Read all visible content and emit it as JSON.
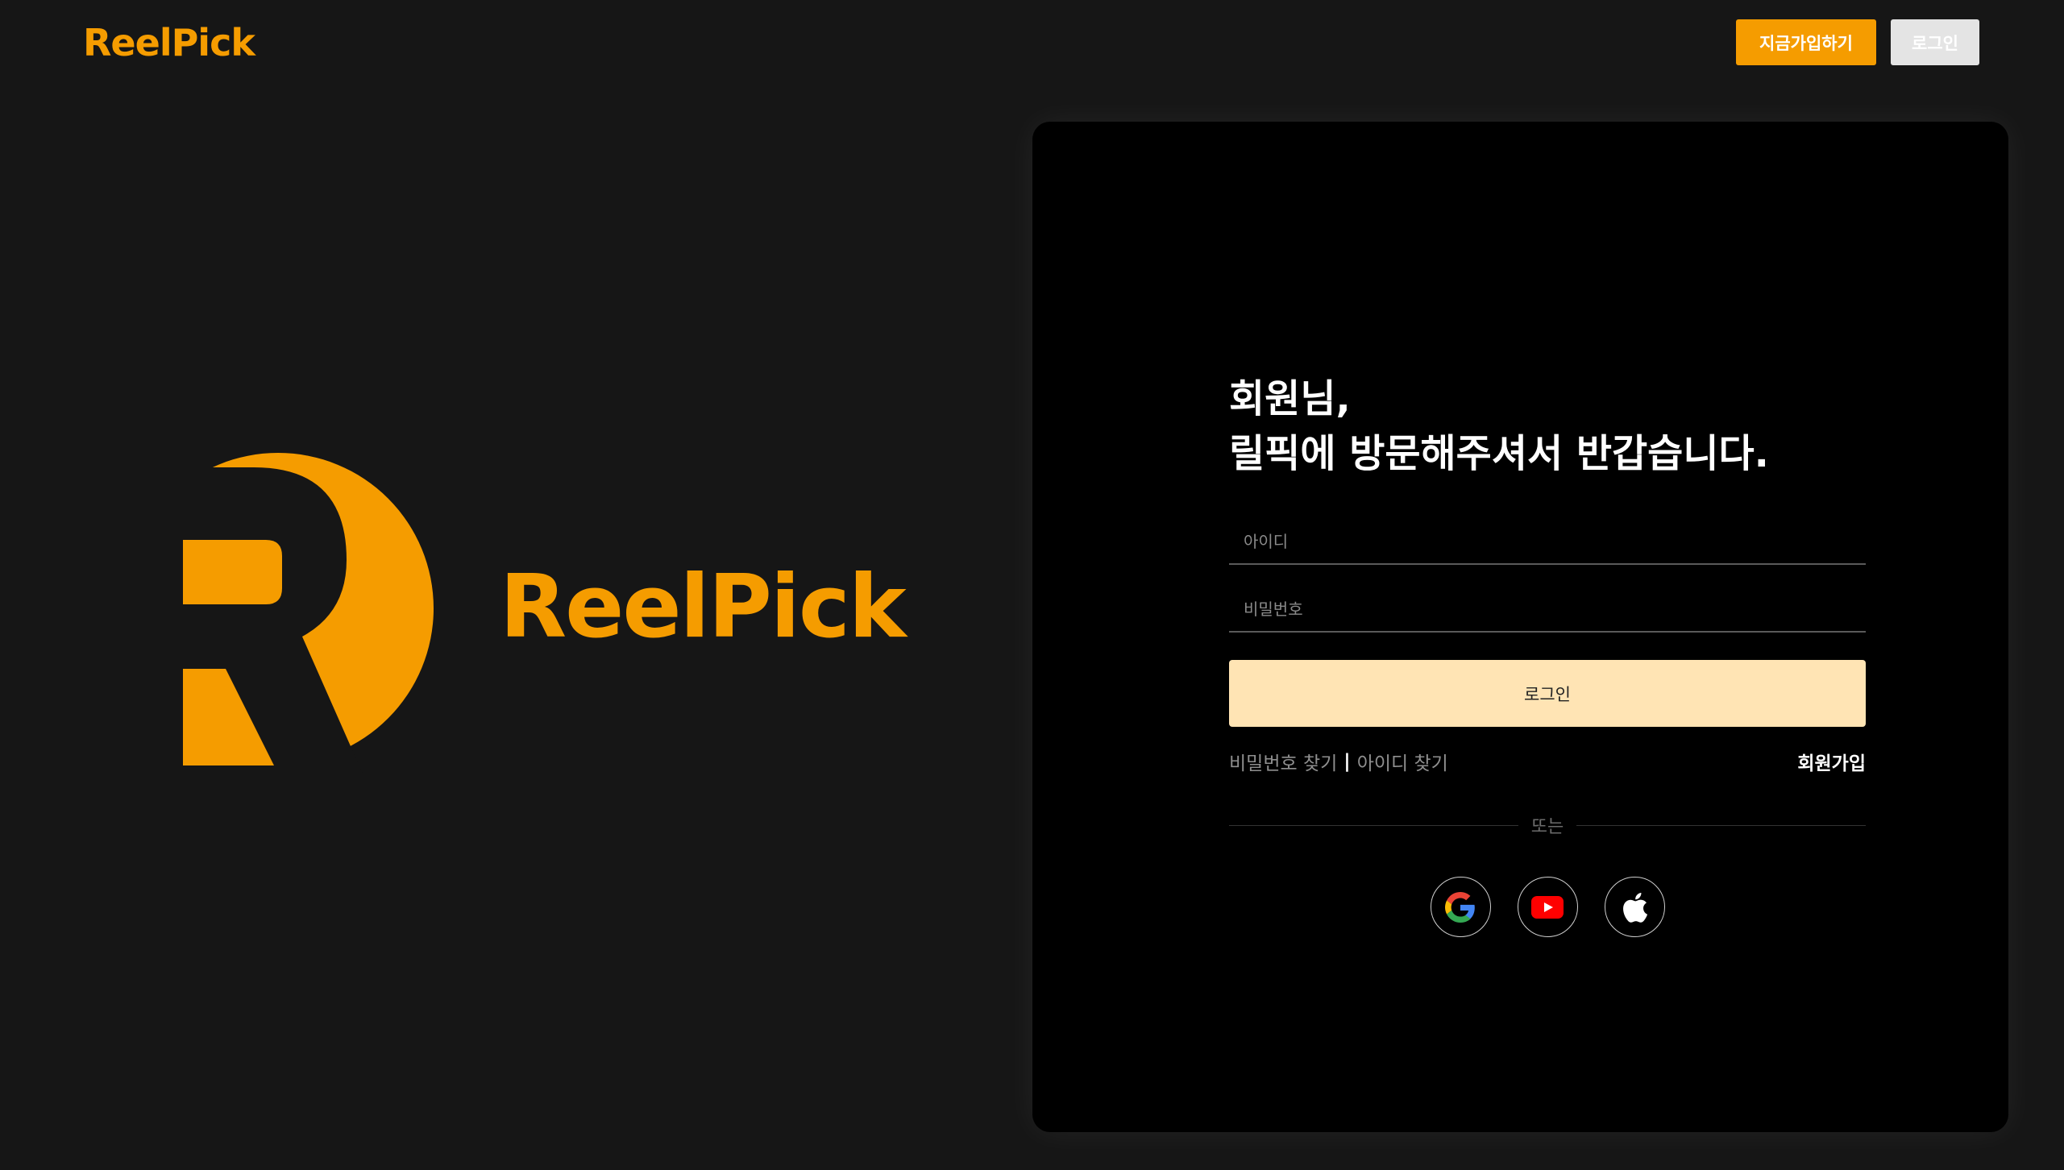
{
  "brand": {
    "name_part1": "Reel",
    "name_part2": "Pick",
    "color": "#F59C00"
  },
  "header": {
    "signup_label": "지금가입하기",
    "login_label": "로그인"
  },
  "login": {
    "greeting_line1": "회원님,",
    "greeting_line2": "릴픽에 방문해주셔서 반갑습니다.",
    "id_placeholder": "아이디",
    "password_placeholder": "비밀번호",
    "submit_label": "로그인",
    "find_password_label": "비밀번호 찾기",
    "separator": "|",
    "find_id_label": "아이디 찾기",
    "signup_label": "회원가입",
    "divider_label": "또는",
    "social": [
      {
        "icon": "google-icon"
      },
      {
        "icon": "youtube-icon"
      },
      {
        "icon": "apple-icon"
      }
    ]
  },
  "colors": {
    "accent": "#F59C00",
    "login_button": "#FFE4B4",
    "background": "#161616",
    "card": "#000000"
  }
}
